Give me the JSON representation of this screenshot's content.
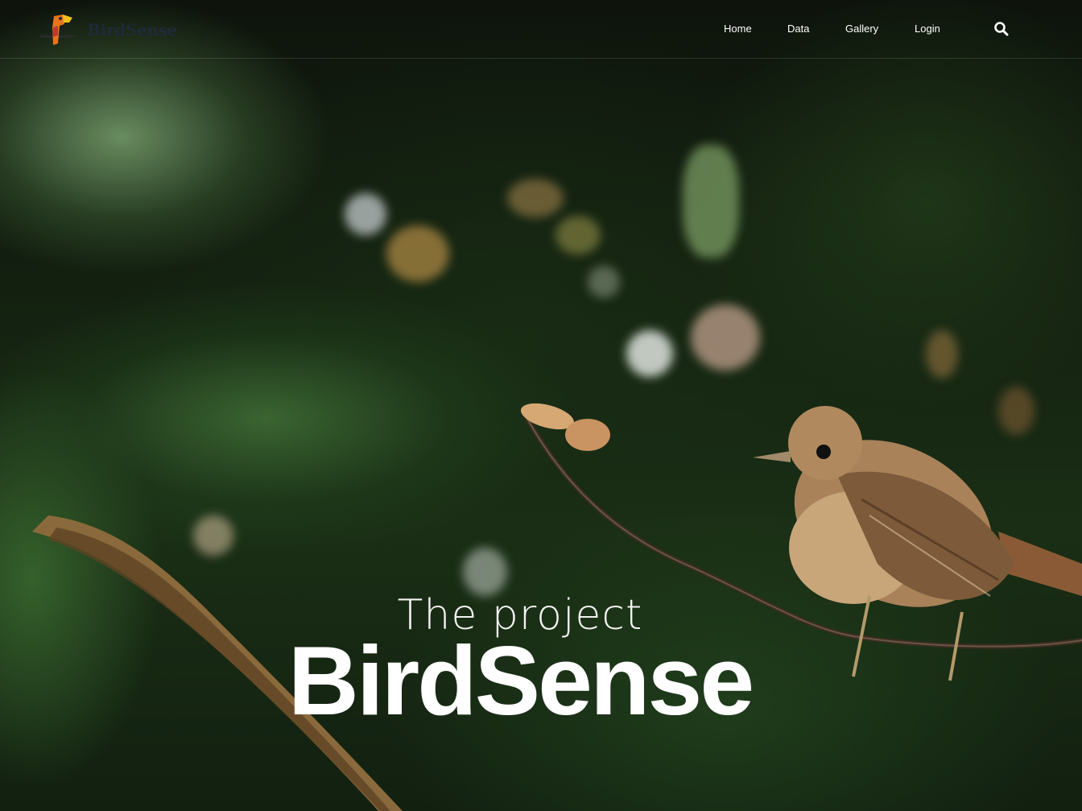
{
  "brand": {
    "name": "BirdSense",
    "logo_icon": "toucan-logo-icon"
  },
  "nav": {
    "items": [
      {
        "label": "Home"
      },
      {
        "label": "Data"
      },
      {
        "label": "Gallery"
      },
      {
        "label": "Login"
      }
    ],
    "search_icon": "search-icon"
  },
  "hero": {
    "subtitle": "The project",
    "title": "BirdSense"
  },
  "colors": {
    "logo_text": "#1e2a38",
    "nav_text": "#ffffff",
    "hero_text": "#ffffff",
    "logo_orange": "#e8741c",
    "logo_yellow": "#f2c01e",
    "logo_red": "#c0392b"
  }
}
